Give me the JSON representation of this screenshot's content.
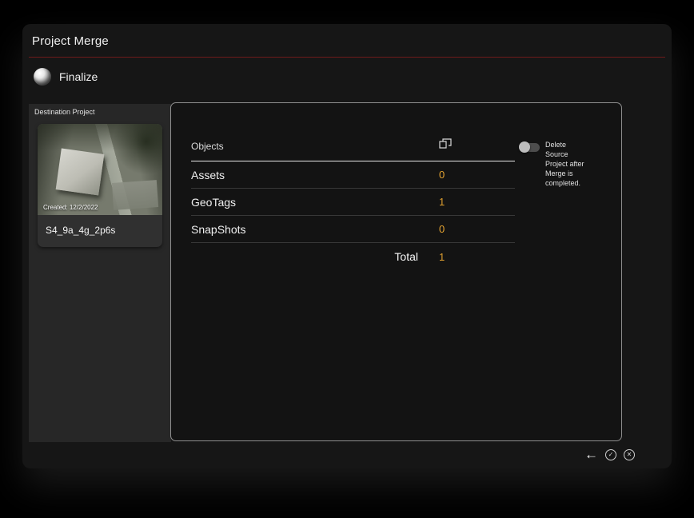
{
  "window": {
    "title": "Project Merge"
  },
  "finalize": {
    "label": "Finalize"
  },
  "destination": {
    "section_label": "Destination Project",
    "created": "Created: 12/2/2022",
    "project_name": "S4_9a_4g_2p6s"
  },
  "objects_table": {
    "header": "Objects",
    "header_icon": "merge-count-icon",
    "rows": [
      {
        "label": "Assets",
        "value": "0"
      },
      {
        "label": "GeoTags",
        "value": "1"
      },
      {
        "label": "SnapShots",
        "value": "0"
      }
    ],
    "total_label": "Total",
    "total_value": "1"
  },
  "delete_source": {
    "label": "Delete Source Project after Merge is completed.",
    "state": "off"
  },
  "actions": {
    "back_glyph": "←",
    "confirm_glyph": "✓",
    "cancel_glyph": "✕"
  },
  "colors": {
    "accent_orange": "#e0a030",
    "divider_red": "#6e1b1b",
    "window_bg": "#161616"
  }
}
